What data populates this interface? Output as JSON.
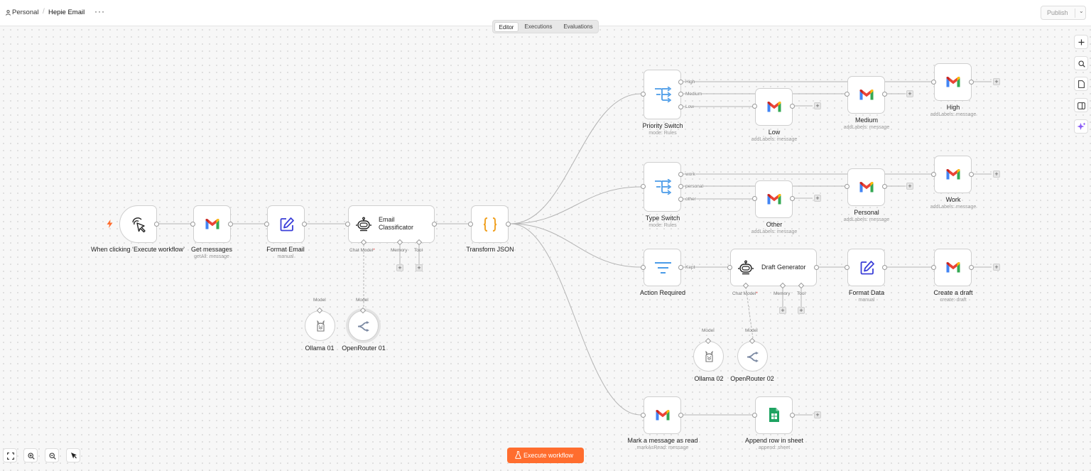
{
  "header": {
    "project": "Personal",
    "workflow_name": "Hepie Email",
    "more_icon": "more-horizontal-icon",
    "publish_label": "Publish"
  },
  "tabs": [
    "Editor",
    "Executions",
    "Evaluations"
  ],
  "active_tab": "Editor",
  "nodes": {
    "trigger": {
      "label": "When clicking ‘Execute workflow’",
      "icon": "cursor-click-icon"
    },
    "get_messages": {
      "label": "Get messages",
      "sub": "getAll: message",
      "icon": "gmail-icon"
    },
    "format_email": {
      "label": "Format Email",
      "sub": "manual",
      "icon": "edit-icon"
    },
    "classificator": {
      "label": "Email Classificator",
      "icon": "robot-icon",
      "ports": {
        "chat_model": "Chat Model",
        "memory": "Memory",
        "tool": "Tool"
      }
    },
    "ollama1": {
      "label": "Ollama 01",
      "port": "Model",
      "icon": "llama-icon"
    },
    "openrouter1": {
      "label": "OpenRouter 01",
      "port": "Model",
      "icon": "openrouter-icon"
    },
    "transform_json": {
      "label": "Transform JSON",
      "icon": "braces-icon"
    },
    "priority_switch": {
      "label": "Priority Switch",
      "sub": "mode: Rules",
      "outputs": [
        "High",
        "Medium",
        "Low"
      ],
      "icon": "switch-icon"
    },
    "low": {
      "label": "Low",
      "sub": "addLabels: message"
    },
    "medium": {
      "label": "Medium",
      "sub": "addLabels: message"
    },
    "high": {
      "label": "High",
      "sub": "addLabels: message"
    },
    "type_switch": {
      "label": "Type Switch",
      "sub": "mode: Rules",
      "outputs": [
        "work",
        "personal",
        "other"
      ],
      "icon": "switch-icon"
    },
    "other": {
      "label": "Other",
      "sub": "addLabels: message"
    },
    "personal": {
      "label": "Personal",
      "sub": "addLabels: message"
    },
    "work": {
      "label": "Work",
      "sub": "addLabels: message"
    },
    "action_required": {
      "label": "Action Required",
      "output": "Kept",
      "icon": "filter-icon"
    },
    "draft_generator": {
      "label": "Draft Generator",
      "icon": "robot-icon",
      "ports": {
        "chat_model": "Chat Model",
        "memory": "Memory",
        "tool": "Tool"
      }
    },
    "format_data": {
      "label": "Format Data",
      "sub": "manual",
      "icon": "edit-icon"
    },
    "create_draft": {
      "label": "Create a draft",
      "sub": "create: draft",
      "icon": "gmail-icon"
    },
    "ollama2": {
      "label": "Ollama 02",
      "port": "Model",
      "icon": "llama-icon"
    },
    "openrouter2": {
      "label": "OpenRouter 02",
      "port": "Model",
      "icon": "openrouter-icon"
    },
    "mark_read": {
      "label": "Mark a message as read",
      "sub": "markAsRead: message",
      "icon": "gmail-icon"
    },
    "append_row": {
      "label": "Append row in sheet",
      "sub": "append: sheet",
      "icon": "google-sheets-icon"
    }
  },
  "execute_button": "Execute workflow",
  "colors": {
    "accent": "#ff6d2e",
    "switch_blue": "#4a9be8",
    "braces_orange": "#f0a020",
    "sheets_green": "#1ea362",
    "edit_blue": "#3b3fd8",
    "ai_purple": "#8b5cf6"
  }
}
